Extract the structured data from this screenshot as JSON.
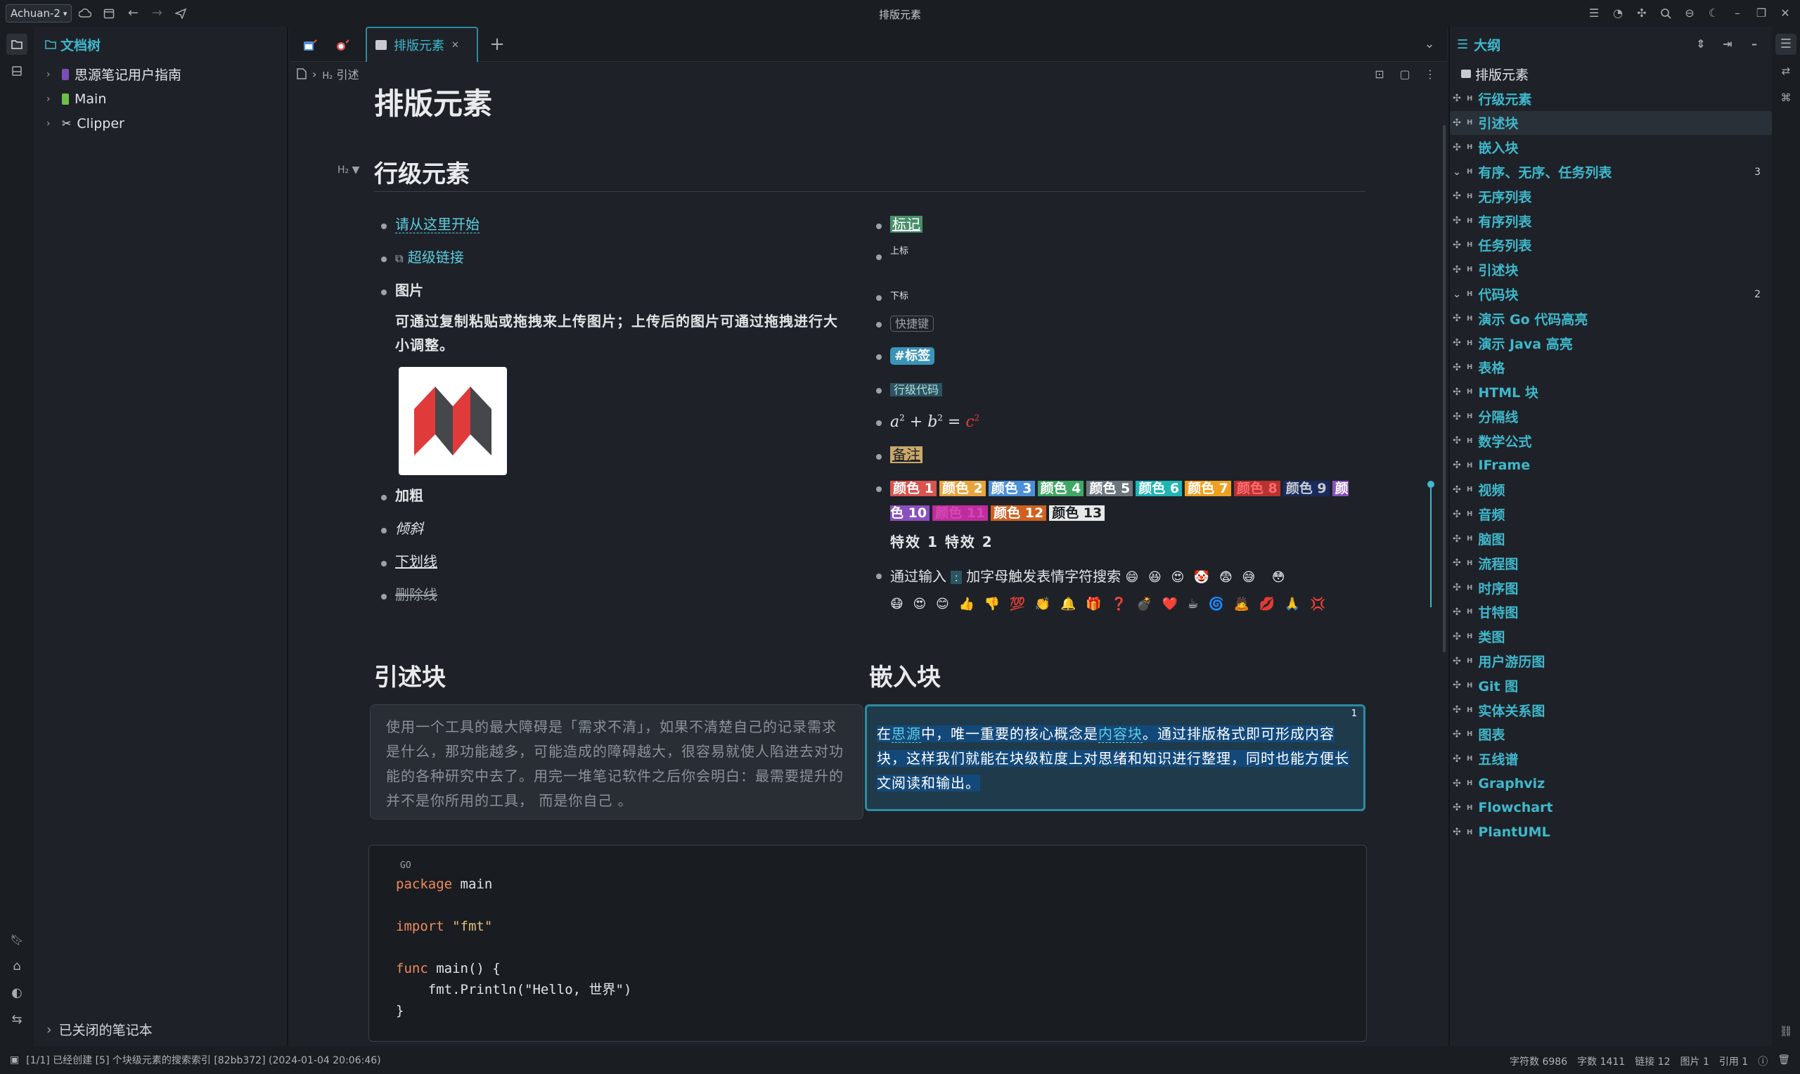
{
  "window": {
    "title": "排版元素",
    "workspace": "Achuan-2"
  },
  "tree": {
    "title": "文档树",
    "items": [
      {
        "label": "思源笔记用户指南",
        "icon": "book-purple"
      },
      {
        "label": "Main",
        "icon": "book-green"
      },
      {
        "label": "Clipper",
        "icon": "scissors"
      }
    ],
    "closed": "已关闭的笔记本"
  },
  "tabs": {
    "active": "排版元素"
  },
  "crumb": {
    "level": "H₂",
    "text": "引述"
  },
  "doc": {
    "title": "排版元素",
    "h2_inline": "行级元素",
    "h2_mark": "H₂",
    "left": {
      "start": "请从这里开始",
      "link": "超级链接",
      "image": "图片",
      "image_desc": "可通过复制粘贴或拖拽来上传图片；上传后的图片可通过拖拽进行大小调整。",
      "bold": "加粗",
      "italic": "倾斜",
      "underline": "下划线",
      "strike": "删除线"
    },
    "right": {
      "mark": "标记",
      "sup": "上标",
      "sub": "下标",
      "kbd": "快捷键",
      "tag": "#标签",
      "code": "行级代码",
      "math_a": "a",
      "math_b": "b",
      "math_c": "c",
      "math_exp": "2",
      "remark": "备注",
      "colors": [
        {
          "t": "颜色 1",
          "bg": "#d9534f",
          "fg": "#fff"
        },
        {
          "t": "颜色 2",
          "bg": "#e8a33d",
          "fg": "#fff"
        },
        {
          "t": "颜色 3",
          "bg": "#4a90d9",
          "fg": "#fff"
        },
        {
          "t": "颜色 4",
          "bg": "#3fa864",
          "fg": "#fff"
        },
        {
          "t": "颜色 5",
          "bg": "#6c757d",
          "fg": "#fff"
        },
        {
          "t": "颜色 6",
          "bg": "#1fb5b5",
          "fg": "#fff"
        },
        {
          "t": "颜色 7",
          "bg": "#f0a020",
          "fg": "#fff"
        },
        {
          "t": "颜色 8",
          "bg": "#b83232",
          "fg": "#ff6b6b"
        },
        {
          "t": "颜色 9",
          "bg": "#1a2a5a",
          "fg": "#c7cbd0"
        },
        {
          "t": "颜色 10",
          "bg": "#8a4fc0",
          "fg": "#fff"
        },
        {
          "t": "颜色 11",
          "bg": "#c02ca0",
          "fg": "#d04ab0"
        },
        {
          "t": "颜色 12",
          "bg": "#d06020",
          "fg": "#fff"
        },
        {
          "t": "颜色 13",
          "bg": "#e8e8e8",
          "fg": "#1e2228"
        }
      ],
      "effects": "特效 1 特效 2",
      "emoji_lead": "通过输入",
      "emoji_colon": ":",
      "emoji_text": "加字母触发表情字符搜索",
      "emojis": "😄 😆 😍 🤡 😨 😅  😳\n😷 😍 😊 👍 👎 💯 👏 🔔 🎁 ❓ 💣 ❤️ ☕ 🌀 🙇 💋 🙏 💢"
    },
    "h2_quote": "引述块",
    "h2_embed": "嵌入块",
    "quote": "使用一个工具的最大障碍是「需求不清」，如果不清楚自己的记录需求是什么，那功能越多，可能造成的障碍越大，很容易就使人陷进去对功能的各种研究中去了。用完一堆笔记软件之后你会明白：最需要提升的并不是你所用的工具， 而是你自己 。",
    "embed": {
      "p1": "在",
      "l1": "思源",
      "p2": "中，唯一重要的核心概念是",
      "l2": "内容块",
      "p3": "。通过排版格式即可形成内容块，这样我们就能在块级粒度上对思绪和知识进行整理，同时也能方便长文阅读和输出。",
      "badge": "1"
    },
    "code": {
      "lang": "GO",
      "l1a": "package",
      "l1b": " main",
      "l2a": "import",
      "l2b": " \"fmt\"",
      "l3a": "func",
      "l3b": " main() {",
      "l4": "    fmt.Println(\"Hello, 世界\")",
      "l5": "}"
    }
  },
  "outline": {
    "title": "大纲",
    "root": "排版元素",
    "items": [
      {
        "label": "行级元素",
        "lvl": 0
      },
      {
        "label": "引述块",
        "lvl": 0,
        "sel": true
      },
      {
        "label": "嵌入块",
        "lvl": 0
      },
      {
        "label": "有序、无序、任务列表",
        "lvl": 0,
        "open": true,
        "count": "3"
      },
      {
        "label": "无序列表",
        "lvl": 1
      },
      {
        "label": "有序列表",
        "lvl": 1
      },
      {
        "label": "任务列表",
        "lvl": 1
      },
      {
        "label": "引述块",
        "lvl": 0
      },
      {
        "label": "代码块",
        "lvl": 0,
        "open": true,
        "count": "2"
      },
      {
        "label": "演示 Go 代码高亮",
        "lvl": 1
      },
      {
        "label": "演示 Java 高亮",
        "lvl": 1
      },
      {
        "label": "表格",
        "lvl": 0
      },
      {
        "label": "HTML 块",
        "lvl": 0
      },
      {
        "label": "分隔线",
        "lvl": 0
      },
      {
        "label": "数学公式",
        "lvl": 0
      },
      {
        "label": "IFrame",
        "lvl": 0
      },
      {
        "label": "视频",
        "lvl": 0
      },
      {
        "label": "音频",
        "lvl": 0
      },
      {
        "label": "脑图",
        "lvl": 0
      },
      {
        "label": "流程图",
        "lvl": 0
      },
      {
        "label": "时序图",
        "lvl": 0
      },
      {
        "label": "甘特图",
        "lvl": 0
      },
      {
        "label": "类图",
        "lvl": 0
      },
      {
        "label": "用户游历图",
        "lvl": 0
      },
      {
        "label": "Git 图",
        "lvl": 0
      },
      {
        "label": "实体关系图",
        "lvl": 0
      },
      {
        "label": "图表",
        "lvl": 0
      },
      {
        "label": "五线谱",
        "lvl": 0
      },
      {
        "label": "Graphviz",
        "lvl": 0
      },
      {
        "label": "Flowchart",
        "lvl": 0
      },
      {
        "label": "PlantUML",
        "lvl": 0
      }
    ]
  },
  "status": {
    "left": "[1/1] 已经创建 [5] 个块级元素的搜索索引 [82bb372] (2024-01-04 20:06:46)",
    "chars": "字符数 6986",
    "words": "字数 1411",
    "links": "链接 12",
    "images": "图片 1",
    "refs": "引用 1"
  }
}
